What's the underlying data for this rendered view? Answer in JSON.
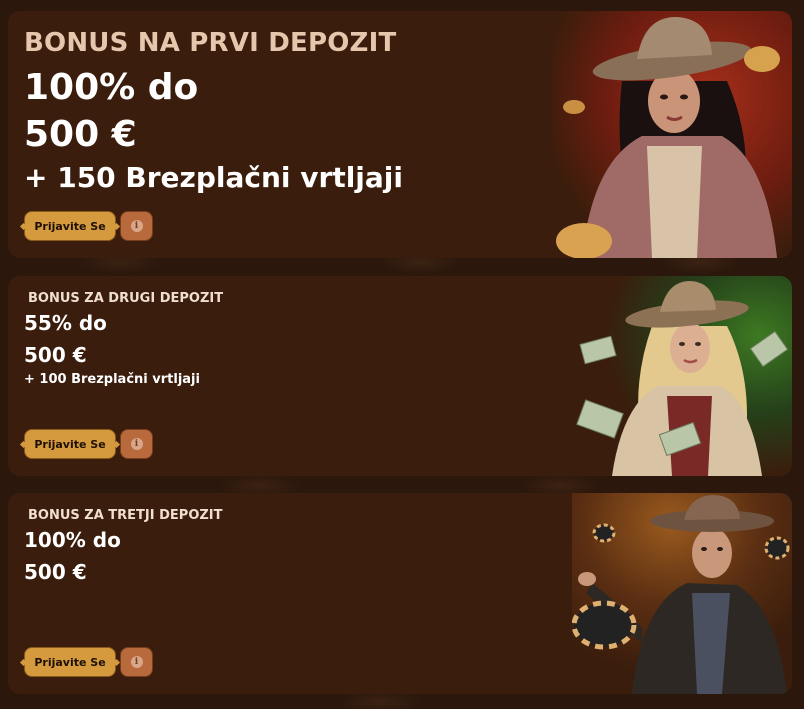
{
  "cards": [
    {
      "label": "BONUS NA PRVI DEPOZIT",
      "headline1": "100% do",
      "headline2": "500 €",
      "extra": "+ 150 Brezplačni vrtljaji",
      "button": "Prijavite Se",
      "info_icon": "info-icon",
      "background_accent": "#8b2a18"
    },
    {
      "label": "BONUS ZA DRUGI DEPOZIT",
      "headline1": "55% do",
      "headline2": "500 €",
      "extra": "+ 100 Brezplačni vrtljaji",
      "button": "Prijavite Se",
      "info_icon": "info-icon",
      "background_accent": "#2f5a1c"
    },
    {
      "label": "BONUS ZA TRETJI DEPOZIT",
      "headline1": "100% do",
      "headline2": "500 €",
      "button": "Prijavite Se",
      "info_icon": "info-icon",
      "background_accent": "#8a4a16"
    }
  ],
  "colors": {
    "page_bg": "#2b170c",
    "card_bg": "#3a1d0c",
    "button_gold": "#d49a3d",
    "info_button": "#b86a3c",
    "label_text": "#e6c7ad"
  }
}
